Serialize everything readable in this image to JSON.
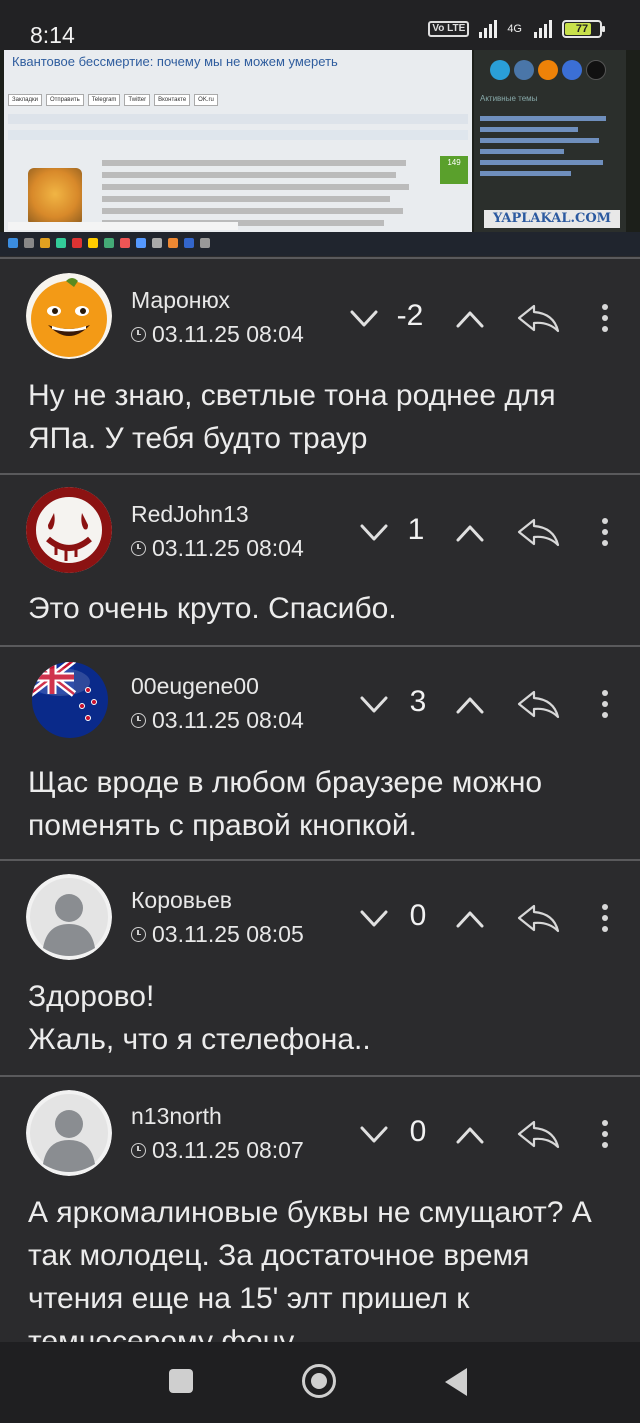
{
  "status_bar": {
    "time": "8:14",
    "volte": "Vo LTE",
    "network": "4G",
    "battery": "77"
  },
  "embedded_screenshot": {
    "forum_title": "Квантовое бессмертие: почему мы не можем умереть",
    "share_buttons": [
      "Закладки",
      "Отправить",
      "Telegram",
      "Twitter",
      "Вконтакте",
      "OK.ru"
    ],
    "side_heading": "Активные темы",
    "logo": "YAPLAKAL.COM",
    "post_counter": "149"
  },
  "comments": [
    {
      "username": "Маронюх",
      "date": "03.11.25 08:04",
      "rating": "-2",
      "text": "Ну не знаю, светлые тона роднее для ЯПа. У тебя будто траур"
    },
    {
      "username": "RedJohn13",
      "date": "03.11.25 08:04",
      "rating": "1",
      "text": "Это очень круто. Спасибо."
    },
    {
      "username": "00eugene00",
      "date": "03.11.25 08:04",
      "rating": "3",
      "text": "Щас вроде в любом браузере можно поменять с правой кнопкой."
    },
    {
      "username": "Коровьев",
      "date": "03.11.25 08:05",
      "rating": "0",
      "text": "Здорово!\nЖаль, что я стелефона.."
    },
    {
      "username": "n13north",
      "date": "03.11.25 08:07",
      "rating": "0",
      "text": "А яркомалиновые буквы не смущают? А так молодец. За достаточное время чтения еще на 15' элт пришел к темносерому фону"
    }
  ]
}
